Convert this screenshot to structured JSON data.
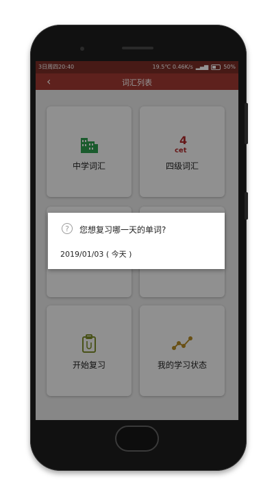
{
  "status": {
    "time": "3日周四20:40",
    "temp_net": "19.5℃ 0.46K/s",
    "battery": "50%"
  },
  "appbar": {
    "title": "词汇列表"
  },
  "cards": [
    {
      "label": "中学词汇",
      "icon": "building-icon",
      "color": "#2e9e4f"
    },
    {
      "label": "四级词汇",
      "icon": "cet4-icon",
      "color": "#b0292a"
    },
    {
      "label": "",
      "icon": "",
      "color": ""
    },
    {
      "label": "",
      "icon": "",
      "color": ""
    },
    {
      "label": "开始复习",
      "icon": "clipboard-icon",
      "color": "#7d8c28"
    },
    {
      "label": "我的学习状态",
      "icon": "trend-icon",
      "color": "#b58a25"
    }
  ],
  "dialog": {
    "message": "您想复习哪一天的单词?",
    "date": "2019/01/03 ( 今天 )"
  }
}
